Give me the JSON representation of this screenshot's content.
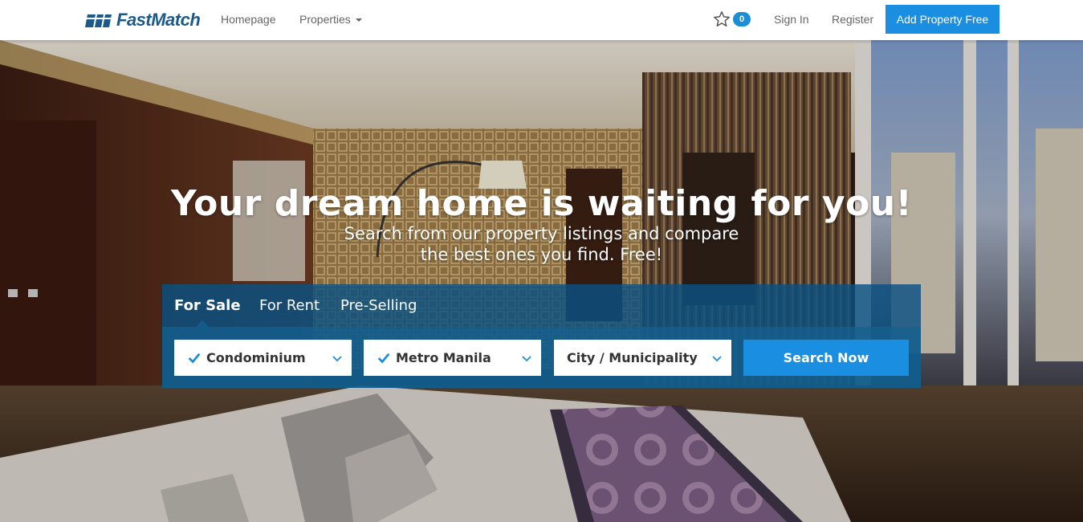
{
  "brand": {
    "name": "FastMatch",
    "color": "#1c5a8a"
  },
  "nav": {
    "homepage": "Homepage",
    "properties": "Properties",
    "favorites_count": "0",
    "sign_in": "Sign In",
    "register": "Register",
    "add_property": "Add Property Free"
  },
  "hero": {
    "title": "Your dream home is waiting for you!",
    "subtitle_line1": "Search from our property listings and compare",
    "subtitle_line2": "the best ones you find. Free!"
  },
  "search": {
    "tabs": [
      {
        "label": "For Sale",
        "active": true
      },
      {
        "label": "For Rent",
        "active": false
      },
      {
        "label": "Pre-Selling",
        "active": false
      }
    ],
    "property_type": "Condominium",
    "region": "Metro Manila",
    "city_placeholder": "City / Municipality",
    "button": "Search Now"
  },
  "colors": {
    "accent": "#1a8ee0",
    "panel": "#125d8c"
  }
}
